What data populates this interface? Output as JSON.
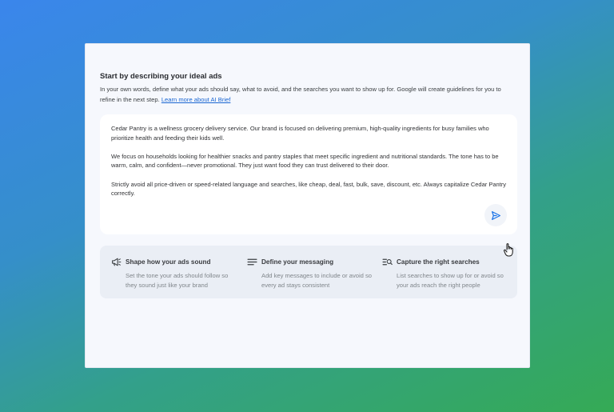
{
  "brief": {
    "heading": "Start by describing your ideal ads",
    "intro_text": "In your own words, define what your ads should say, what to avoid, and the searches you want to show up for. Google will create guidelines for you to refine in the next step. ",
    "intro_link": "Learn more about AI Brief"
  },
  "prompt": {
    "paragraph_1": "Cedar Pantry is a wellness grocery delivery service. Our brand is focused on delivering premium, high-quality ingredients for busy families who prioritize health and feeding their kids well.",
    "paragraph_2": "We focus on households looking for healthier snacks and pantry staples that meet specific ingredient and nutritional standards. The tone has to be warm, calm, and confident—never promotional. They just want food they can trust delivered to their door.",
    "paragraph_3": "Strictly avoid all price-driven or speed-related language and searches, like cheap, deal, fast, bulk, save, discount, etc. Always capitalize Cedar Pantry correctly.",
    "send_icon": "send-icon"
  },
  "tips": [
    {
      "icon": "megaphone-icon",
      "title": "Shape how your ads sound",
      "description": "Set the tone your ads should follow so they sound just like your brand"
    },
    {
      "icon": "lines-icon",
      "title": "Define your messaging",
      "description": "Add key messages to include or avoid so every ad stays consistent"
    },
    {
      "icon": "search-list-icon",
      "title": "Capture the right searches",
      "description": "List searches to show up for or avoid so your ads reach the right people"
    }
  ],
  "colors": {
    "accent": "#1a73e8",
    "panel_bg": "#f6f8fd",
    "tips_bg": "#eaeef5"
  }
}
